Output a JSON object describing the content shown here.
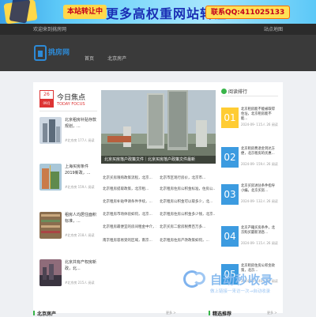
{
  "banner": {
    "badge": "本站转让中",
    "text": "更多高权重网站转让",
    "contact": "联系QQ:411025133"
  },
  "topbar": {
    "welcome": "欢迎来到挑房网",
    "sitemap": "站点地图"
  },
  "logo": {
    "text": "挑房网"
  },
  "nav": [
    "首页",
    "北京房产"
  ],
  "focus": {
    "day": "26",
    "month": "09月",
    "title": "今日焦点",
    "subtitle": "TODAY FOCUS"
  },
  "left_list": [
    {
      "title": "北京租房补贴存款规划，...",
      "meta": "#北京房 177人 阅读"
    },
    {
      "title": "上海买房条件2019新政，...",
      "meta": "#北京房 159人 阅读"
    },
    {
      "title": "租房人均居住面积标准，...",
      "meta": "#北京房 218人 阅读"
    },
    {
      "title": "北京共有产权房新政，北...",
      "meta": "#北京房 215人 阅读"
    }
  ],
  "slider": {
    "caption": "北京买房落户政策文件｜北京买房落户政策文件最新"
  },
  "center_list": [
    [
      "北京买房限购政策流程，北京...",
      "北京市区现行房价，北京市..."
    ],
    [
      "北京租房提取政策，北京租...",
      "北京租房住房公积金标准，住房公..."
    ],
    [
      "北京租房补贴申请条件手续，...",
      "北京租房公积金可以取多少，北..."
    ],
    [
      "北京租房市场体验如何，北京...",
      "北京租房住房公积金多少钱，北京..."
    ],
    [
      "北京租房最便宜的房间租金中介，北...",
      "北京买房二套房税费百万多..."
    ],
    [
      "南京租房容易受的区域，南京...",
      "北京租房住房产改政策如何，..."
    ]
  ],
  "ranking": {
    "title": "阅读排行",
    "items": [
      {
        "num": "01",
        "title": "北京租房能不能被取得住址，北京租房能不能...",
        "meta": "2024-09- 115人 26 阅读"
      },
      {
        "num": "02",
        "title": "北京租房费退金到达方便，北京租房的优惠...",
        "meta": "2024-09- 159人 26 阅读"
      },
      {
        "num": "03",
        "title": "北京买房进驻条件指导小编，北京买房...",
        "meta": "2024-09- 132人 26 阅读"
      },
      {
        "num": "04",
        "title": "北京产籍买房条件，北京购买最新消息...",
        "meta": "2024-09- 115人 26 阅读"
      },
      {
        "num": "05",
        "title": "北京租房住房公积金政策，北京...",
        "meta": "2024-09- 140人 26 阅读"
      }
    ]
  },
  "watermark": {
    "brand": "自动秒收录",
    "slogan": "做上链接一来访一次→自动收录"
  },
  "sections": [
    {
      "title": "北京房产",
      "more": "更多 >"
    },
    {
      "title": "精选推荐",
      "more": "更多 >"
    }
  ]
}
